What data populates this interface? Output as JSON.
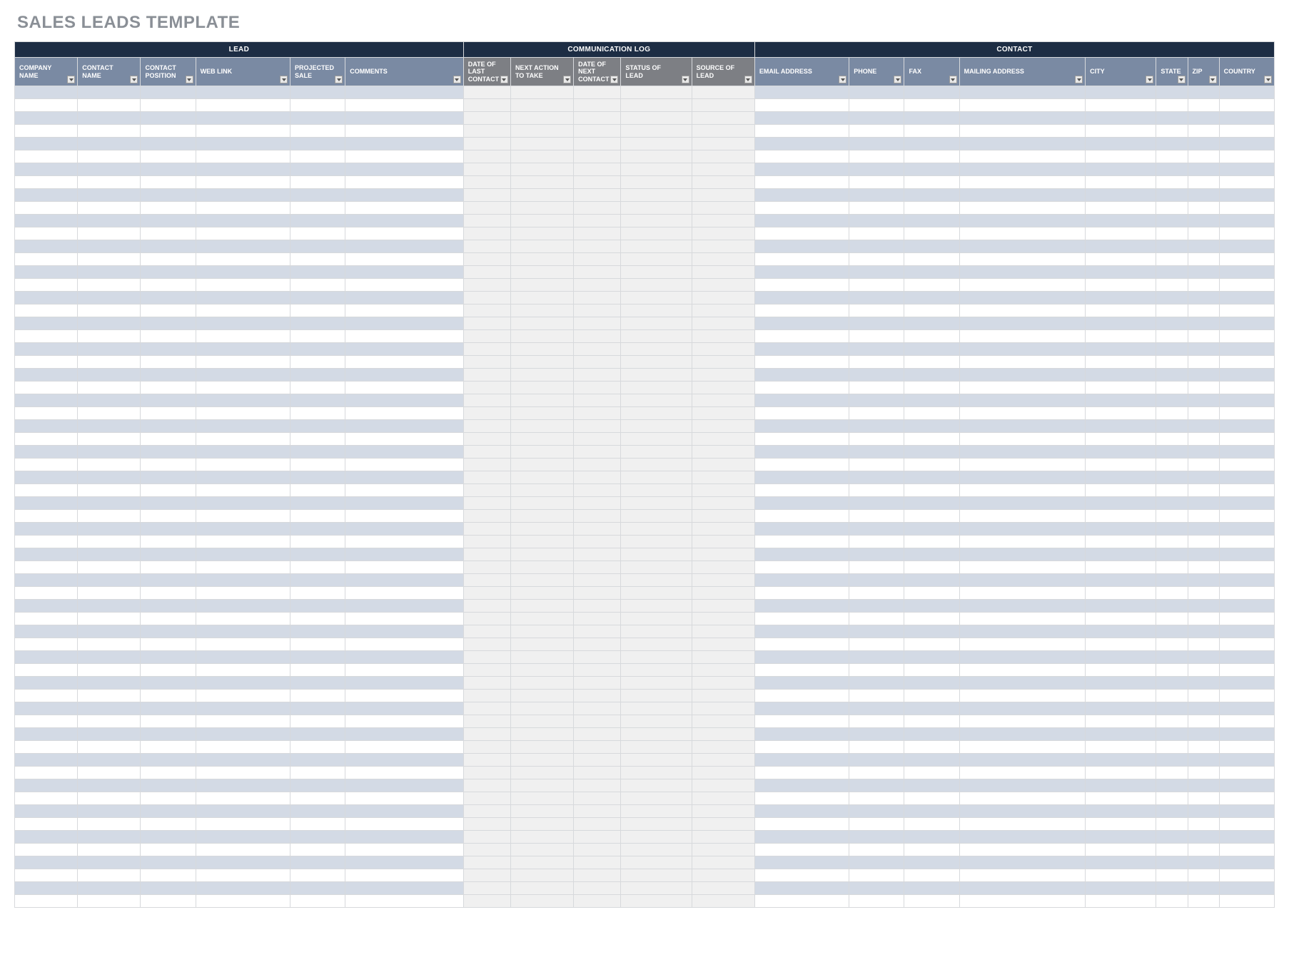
{
  "title": "SALES LEADS TEMPLATE",
  "groups": {
    "lead": "LEAD",
    "comm": "COMMUNICATION LOG",
    "contact": "CONTACT"
  },
  "columns": {
    "company_name": "COMPANY NAME",
    "contact_name": "CONTACT NAME",
    "contact_pos": "CONTACT POSITION",
    "web_link": "WEB LINK",
    "projected_sale": "PROJECTED SALE",
    "comments": "COMMENTS",
    "date_last": "DATE OF LAST CONTACT",
    "next_action": "NEXT ACTION TO TAKE",
    "date_next": "DATE OF NEXT CONTACT",
    "status_lead": "STATUS OF LEAD",
    "source_lead": "SOURCE OF LEAD",
    "email": "EMAIL ADDRESS",
    "phone": "PHONE",
    "fax": "FAX",
    "mailing": "MAILING ADDRESS",
    "city": "CITY",
    "state": "STATE",
    "zip": "ZIP",
    "country": "COUNTRY"
  },
  "row_count": 64,
  "rows": []
}
